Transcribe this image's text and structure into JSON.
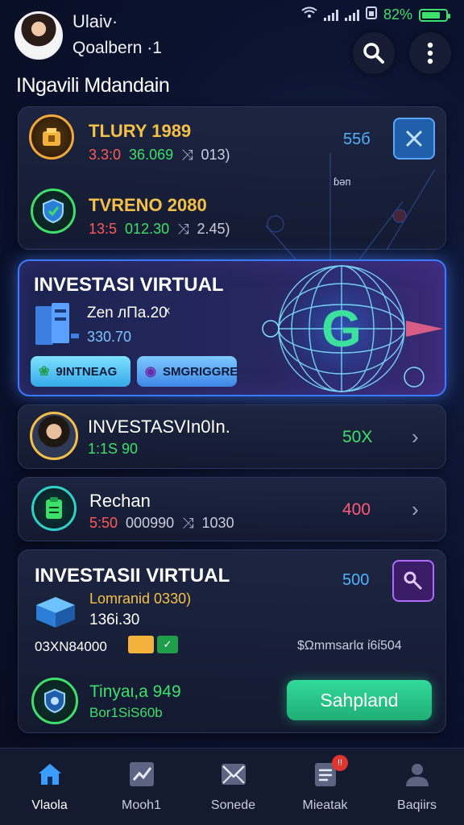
{
  "status_bar": {
    "battery_pct": "82%"
  },
  "header": {
    "user_top": "Ulaiv·",
    "user_sub": "Qoalbern ·1",
    "page_title": "INgavili Mdandain"
  },
  "list_top": [
    {
      "title": "TLURY 1989",
      "meta_a": "3.3:0",
      "meta_b": "36.069",
      "meta_c": "013)",
      "value": "55б",
      "title_color": "#f4c04a"
    },
    {
      "title": "TVRENO 2080",
      "meta_a": "13:5",
      "meta_b": "012.30",
      "meta_c": "2.45)",
      "title_color": "#f4c04a"
    }
  ],
  "virtual": {
    "title": "INVESTASI VIRTUAL",
    "line1": "Zen лПа.20ͯ",
    "line2": "330.70",
    "chip1": "9INTNEAG",
    "chip2": "SMGRIGGRE",
    "small_label": "ɓəп",
    "globe_letter": "G"
  },
  "list_mid": [
    {
      "title": "INVESTASVIn0In.",
      "meta": "1:1S 90",
      "value": "50X"
    },
    {
      "title": "Rechan",
      "meta_a": "5:50",
      "meta_b": "000990",
      "meta_c": "1030",
      "value": "400"
    }
  ],
  "bottom_card": {
    "title": "INVESTASII VIRTUAL",
    "value": "500",
    "line1": "Lomranid 0330)",
    "line2": "136і.30",
    "left_small": "03XN84000",
    "right_small": "$Ωmmsarlα ί6ί504",
    "row_title": "Tinyaι,a 949",
    "row_sub": "Bor1SіS60b",
    "action": "Sahpland"
  },
  "nav": [
    {
      "label": "Vlaola"
    },
    {
      "label": "Mooh1"
    },
    {
      "label": "Sonede"
    },
    {
      "label": "Mieatak"
    },
    {
      "label": "Baqiirs"
    }
  ],
  "colors": {
    "accent_blue": "#3a7bff",
    "gold": "#f4c04a",
    "green": "#3ee06a",
    "red": "#ff5a5a",
    "action_green": "#2bd08f"
  }
}
